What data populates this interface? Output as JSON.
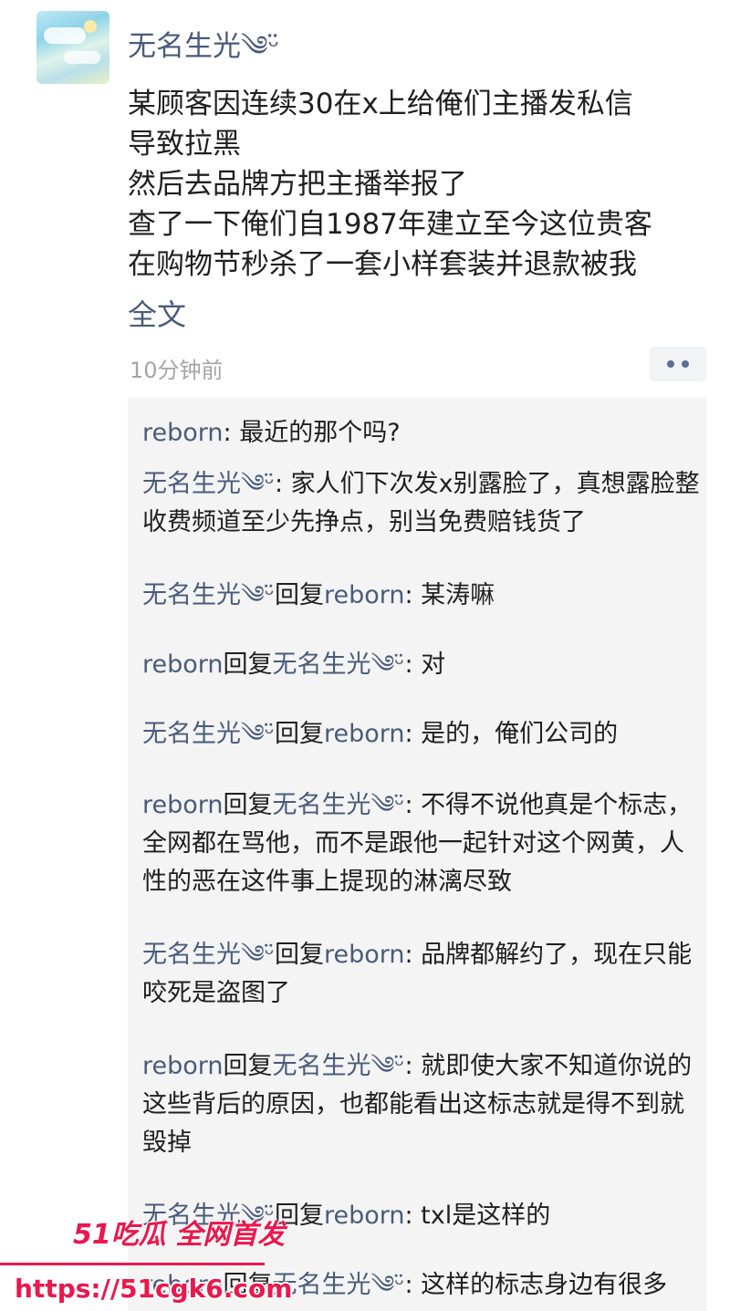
{
  "post": {
    "username": "无名生光༄ᵕ̈",
    "lines": [
      "某顾客因连续30在x上给俺们主播发私信",
      "导致拉黑",
      "然后去品牌方把主播举报了",
      "查了一下俺们自1987年建立至今这位贵客",
      "在购物节秒杀了一套小样套装并退款被我"
    ],
    "full_text_link": "全文",
    "timestamp": "10分钟前"
  },
  "comments": [
    {
      "author": "reborn",
      "reply": "",
      "reply_to": "",
      "sep": ": ",
      "text": "最近的那个吗?"
    },
    {
      "author": "无名生光༄ᵕ̈",
      "reply": "",
      "reply_to": "",
      "sep": ": ",
      "text": "家人们下次发x别露脸了，真想露脸整收费频道至少先挣点，别当免费赔钱货了"
    },
    {
      "author": "无名生光༄ᵕ̈",
      "reply": "回复",
      "reply_to": "reborn",
      "sep": ": ",
      "text": "某涛嘛"
    },
    {
      "author": "reborn",
      "reply": "回复",
      "reply_to": "无名生光༄ᵕ̈",
      "sep": ": ",
      "text": "对"
    },
    {
      "author": "无名生光༄ᵕ̈",
      "reply": "回复",
      "reply_to": "reborn",
      "sep": ": ",
      "text": "是的，俺们公司的"
    },
    {
      "author": "reborn",
      "reply": "回复",
      "reply_to": "无名生光༄ᵕ̈",
      "sep": ": ",
      "text": "不得不说他真是个标志，全网都在骂他，而不是跟他一起针对这个网黄，人性的恶在这件事上提现的淋漓尽致"
    },
    {
      "author": "无名生光༄ᵕ̈",
      "reply": "回复",
      "reply_to": "reborn",
      "sep": ": ",
      "text": "品牌都解约了，现在只能咬死是盗图了"
    },
    {
      "author": "reborn",
      "reply": "回复",
      "reply_to": "无名生光༄ᵕ̈",
      "sep": ": ",
      "text": "就即使大家不知道你说的这些背后的原因，也都能看出这标志就是得不到就毁掉"
    },
    {
      "author": "无名生光༄ᵕ̈",
      "reply": "回复",
      "reply_to": "reborn",
      "sep": ": ",
      "text": "txl是这样的"
    },
    {
      "author": "reborn",
      "reply": "回复",
      "reply_to": "无名生光༄ᵕ̈",
      "sep": ": ",
      "text": "这样的标志身边有很多"
    }
  ],
  "watermark": {
    "logo_text": "51吃瓜 全网首发",
    "url": "https://51cgk6.com"
  },
  "colors": {
    "name_link": "#4a5b7a",
    "watermark": "#e8194d",
    "comment_bg": "#f4f4f4"
  }
}
